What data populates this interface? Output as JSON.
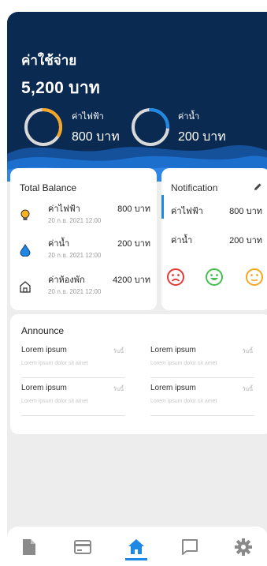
{
  "header": {
    "title": "ค่าใช้จ่าย",
    "total": "5,200 บาท",
    "gauges": [
      {
        "label": "ค่าไฟฟ้า",
        "value": "800 บาท",
        "color": "#f5a623",
        "fraction": 0.33
      },
      {
        "label": "ค่าน้ำ",
        "value": "200 บาท",
        "color": "#1e88e5",
        "fraction": 0.25
      }
    ]
  },
  "balance": {
    "title": "Total Balance",
    "items": [
      {
        "icon": "lightbulb-icon",
        "name": "ค่าไฟฟ้า",
        "amount": "800 บาท",
        "date": "20 ก.ย. 2021 12:00"
      },
      {
        "icon": "water-drop-icon",
        "name": "ค่าน้ำ",
        "amount": "200 บาท",
        "date": "20 ก.ย. 2021 12:00"
      },
      {
        "icon": "home-outline-icon",
        "name": "ค่าห้องพัก",
        "amount": "4200 บาท",
        "date": "20 ก.ย. 2021 12:00"
      }
    ]
  },
  "notification": {
    "title": "Notification",
    "items": [
      {
        "name": "ค่าไฟฟ้า",
        "amount": "800 บาท"
      },
      {
        "name": "ค่าน้ำ",
        "amount": "200 บาท"
      }
    ],
    "faces": [
      {
        "icon": "sad-face-icon",
        "color": "#e53935"
      },
      {
        "icon": "happy-face-icon",
        "color": "#43c04a"
      },
      {
        "icon": "neutral-face-icon",
        "color": "#f5a623"
      }
    ]
  },
  "announce": {
    "title": "Announce",
    "items": [
      {
        "heading": "Lorem ipsum",
        "tag": "วันนี้",
        "text": "Lorem ipsum dolor sit amet"
      },
      {
        "heading": "Lorem ipsum",
        "tag": "วันนี้",
        "text": "Lorem ipsum dolor sit amet"
      },
      {
        "heading": "Lorem ipsum",
        "tag": "วันนี้",
        "text": "Lorem ipsum dolor sit amet"
      },
      {
        "heading": "Lorem ipsum",
        "tag": "วันนี้",
        "text": "Lorem ipsum dolor sit amet"
      }
    ]
  },
  "nav": {
    "items": [
      {
        "icon": "document-icon",
        "active": false
      },
      {
        "icon": "credit-card-icon",
        "active": false
      },
      {
        "icon": "home-icon",
        "active": true
      },
      {
        "icon": "chat-icon",
        "active": false
      },
      {
        "icon": "settings-icon",
        "active": false
      }
    ],
    "active_color": "#1e88e5",
    "inactive_color": "#8a8a8a"
  }
}
